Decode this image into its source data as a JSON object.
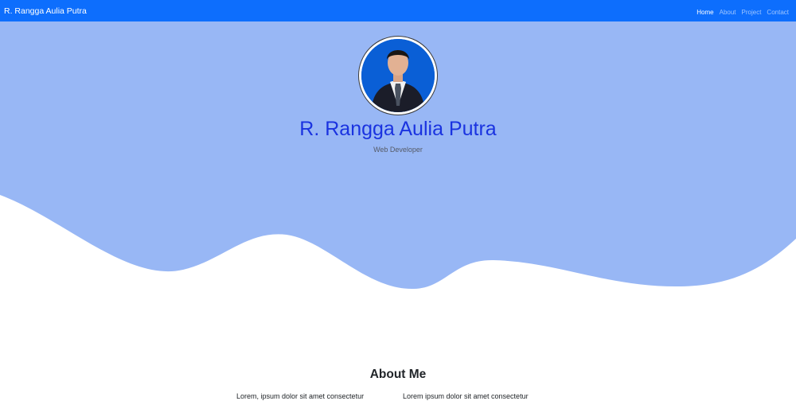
{
  "navbar": {
    "brand": "R. Rangga Aulia Putra",
    "links": [
      {
        "label": "Home",
        "active": true
      },
      {
        "label": "About",
        "active": false
      },
      {
        "label": "Project",
        "active": false
      },
      {
        "label": "Contact",
        "active": false
      }
    ]
  },
  "hero": {
    "name": "R. Rangga Aulia Putra",
    "role": "Web Developer",
    "background_color": "#98b7f5"
  },
  "about": {
    "title": "About Me",
    "paragraphs": [
      "Lorem, ipsum dolor sit amet consectetur",
      "Lorem ipsum dolor sit amet consectetur"
    ]
  },
  "colors": {
    "navbar": "#0d6efd",
    "name_text": "#1a33e0",
    "hero_wave": "#98b7f5"
  }
}
